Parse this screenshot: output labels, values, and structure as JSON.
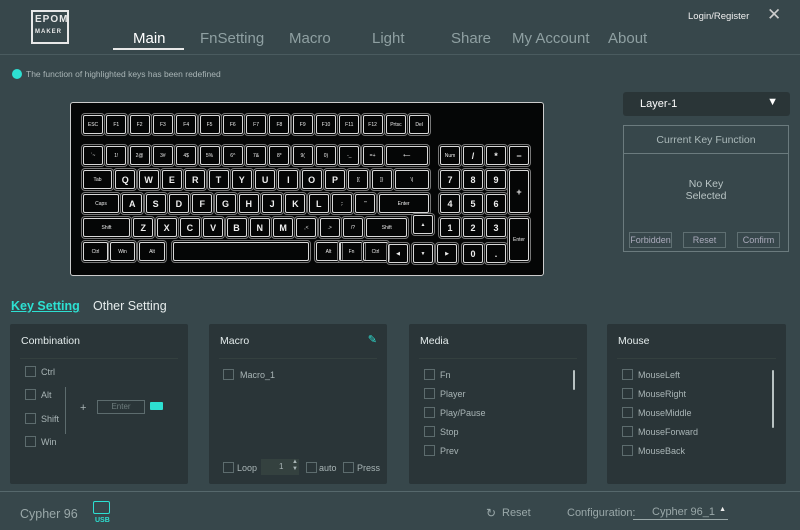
{
  "header": {
    "logo": "EPOM MAKER",
    "login": "Login/Register",
    "close_icon": "close-icon",
    "tabs": [
      "Main",
      "FnSetting",
      "Macro",
      "Light",
      "Share",
      "My Account",
      "About"
    ],
    "active_tab": "Main"
  },
  "notice": {
    "text": "The function of highlighted keys has been redefined",
    "color": "#2de0d2"
  },
  "keyboard": {
    "rows": [
      [
        "ESC",
        "F1",
        "F2",
        "F3",
        "F4",
        "F5",
        "F6",
        "F7",
        "F8",
        "F9",
        "F10",
        "F11",
        "F12",
        "Prtsc",
        "Del"
      ],
      [
        "`~",
        "1!",
        "2@",
        "3#",
        "4$",
        "5%",
        "6^",
        "7&",
        "8*",
        "9(",
        "0)",
        "-_",
        "=+",
        "⟵",
        "Num",
        "/",
        "*",
        "−"
      ],
      [
        "Tab",
        "Q",
        "W",
        "E",
        "R",
        "T",
        "Y",
        "U",
        "I",
        "O",
        "P",
        "[{",
        "]}",
        "\\|",
        "7",
        "8",
        "9",
        "+"
      ],
      [
        "Caps",
        "A",
        "S",
        "D",
        "F",
        "G",
        "H",
        "J",
        "K",
        "L",
        ";:",
        "'\"",
        "Enter",
        "4",
        "5",
        "6"
      ],
      [
        "Shift",
        "Z",
        "X",
        "C",
        "V",
        "B",
        "N",
        "M",
        ",<",
        ".>",
        "/?",
        "Shift",
        "▲",
        "1",
        "2",
        "3",
        "Enter"
      ],
      [
        "Ctrl",
        "Win",
        "Alt",
        "",
        "Alt",
        "Fn",
        "Ctrl",
        "◀",
        "▼",
        "▶",
        "0",
        "."
      ]
    ]
  },
  "layer": {
    "value": "Layer-1"
  },
  "current_key": {
    "title": "Current Key Function",
    "status_line1": "No Key",
    "status_line2": "Selected",
    "forbidden": "Forbidden",
    "reset": "Reset",
    "confirm": "Confirm"
  },
  "settings_tabs": [
    "Key Setting",
    "Other Setting"
  ],
  "combination": {
    "title": "Combination",
    "modifiers": [
      "Ctrl",
      "Alt",
      "Shift",
      "Win"
    ],
    "plus": "+",
    "input_placeholder": "Enter"
  },
  "macro": {
    "title": "Macro",
    "items": [
      "Macro_1"
    ],
    "loop_label": "Loop",
    "loop_count": "1",
    "auto_label": "auto",
    "press_label": "Press"
  },
  "media": {
    "title": "Media",
    "items": [
      "Fn",
      "Player",
      "Play/Pause",
      "Stop",
      "Prev"
    ]
  },
  "mouse": {
    "title": "Mouse",
    "items": [
      "MouseLeft",
      "MouseRight",
      "MouseMiddle",
      "MouseForward",
      "MouseBack"
    ]
  },
  "footer": {
    "device": "Cypher 96",
    "connection": "USB",
    "reset": "Reset",
    "config_label": "Configuration:",
    "config_value": "Cypher 96_1"
  },
  "colors": {
    "accent": "#2de0d2",
    "background": "#37474b",
    "panel": "#2a3538"
  }
}
